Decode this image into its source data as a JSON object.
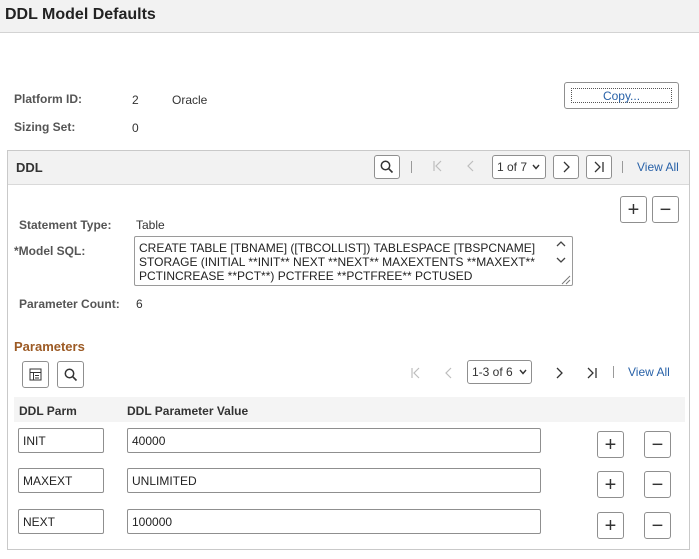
{
  "page": {
    "title": "DDL Model Defaults"
  },
  "platform": {
    "label": "Platform ID:",
    "id": "2",
    "name": "Oracle"
  },
  "sizing": {
    "label": "Sizing Set:",
    "value": "0"
  },
  "copy_button": "Copy...",
  "ddl": {
    "title": "DDL",
    "pager": "1 of 7",
    "view_all": "View All",
    "statement_type_label": "Statement Type:",
    "statement_type_value": "Table",
    "model_sql_label": "*Model SQL:",
    "model_sql_line1": "CREATE TABLE [TBNAME] ([TBCOLLIST]) TABLESPACE [TBSPCNAME]",
    "model_sql_line2": "STORAGE (INITIAL **INIT** NEXT **NEXT** MAXEXTENTS **MAXEXT**",
    "model_sql_line3": "PCTINCREASE **PCT**) PCTFREE **PCTFREE** PCTUSED",
    "param_count_label": "Parameter Count:",
    "param_count_value": "6"
  },
  "parameters": {
    "title": "Parameters",
    "pager": "1-3 of 6",
    "view_all": "View All",
    "col_parm": "DDL Parm",
    "col_value": "DDL Parameter Value",
    "rows": [
      {
        "parm": "INIT",
        "value": "40000"
      },
      {
        "parm": "MAXEXT",
        "value": "UNLIMITED"
      },
      {
        "parm": "NEXT",
        "value": "100000"
      }
    ]
  },
  "icons": {
    "plus": "+",
    "minus": "−",
    "first": "first-page-icon",
    "prev": "prev-page-icon",
    "next": "next-page-icon",
    "last": "last-page-icon",
    "search": "search-icon",
    "grid": "grid-personalize-icon"
  },
  "colors": {
    "link": "#2962a8",
    "section": "#9c5a24",
    "header_bg": "#f2f2f2"
  }
}
